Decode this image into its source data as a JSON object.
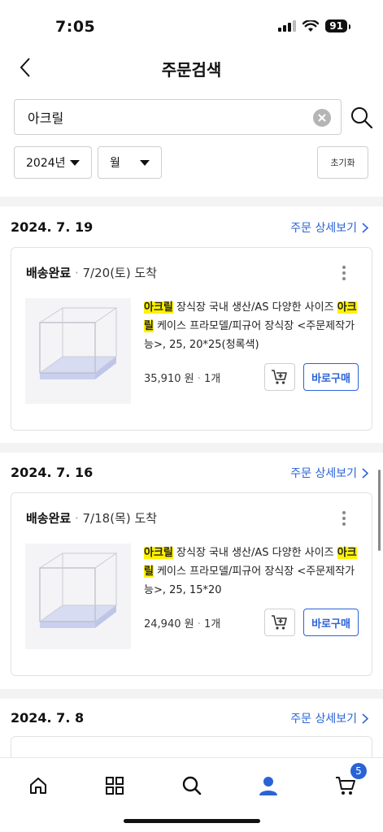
{
  "status_bar": {
    "time": "7:05",
    "battery": "91"
  },
  "header": {
    "title": "주문검색"
  },
  "search": {
    "value": "아크릴"
  },
  "filters": {
    "year": "2024년",
    "month": "월",
    "reset_label": "초기화"
  },
  "orders": [
    {
      "date": "2024. 7. 19",
      "detail_link": "주문 상세보기",
      "status": "배송완료",
      "arrival": "7/20(토) 도착",
      "name_hl1": "아크릴",
      "name_mid": " 장식장 국내 생산/AS 다양한 사이즈 ",
      "name_hl2": "아크릴",
      "name_rest": " 케이스 프라모델/피규어 장식장 <주문제작가능>, 25, 20*25(청록색)",
      "price": "35,910 원",
      "qty": "1개",
      "buy_label": "바로구매"
    },
    {
      "date": "2024. 7. 16",
      "detail_link": "주문 상세보기",
      "status": "배송완료",
      "arrival": "7/18(목) 도착",
      "name_hl1": "아크릴",
      "name_mid": " 장식장 국내 생산/AS 다양한 사이즈 ",
      "name_hl2": "아크릴",
      "name_rest": " 케이스 프라모델/피규어 장식장 <주문제작가능>, 25, 15*20",
      "price": "24,940 원",
      "qty": "1개",
      "buy_label": "바로구매"
    },
    {
      "date": "2024. 7. 8",
      "detail_link": "주문 상세보기"
    }
  ],
  "tab_bar": {
    "items": [
      "home-icon",
      "category-icon",
      "search-icon",
      "my-page-icon",
      "cart-icon"
    ],
    "cart_count": "5"
  },
  "colors": {
    "accent": "#2a63d6",
    "highlight": "#fff200"
  }
}
